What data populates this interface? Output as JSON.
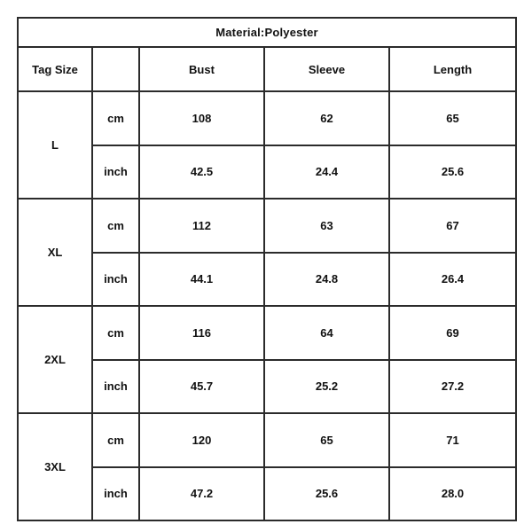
{
  "chart_data": {
    "type": "table",
    "title": "Material:Polyester",
    "columns": [
      "Tag Size",
      "",
      "Bust",
      "Sleeve",
      "Length"
    ],
    "units": [
      "cm",
      "inch"
    ],
    "rows": [
      {
        "tag_size": "L",
        "cm": {
          "unit": "cm",
          "bust": "108",
          "sleeve": "62",
          "length": "65"
        },
        "inch": {
          "unit": "inch",
          "bust": "42.5",
          "sleeve": "24.4",
          "length": "25.6"
        }
      },
      {
        "tag_size": "XL",
        "cm": {
          "unit": "cm",
          "bust": "112",
          "sleeve": "63",
          "length": "67"
        },
        "inch": {
          "unit": "inch",
          "bust": "44.1",
          "sleeve": "24.8",
          "length": "26.4"
        }
      },
      {
        "tag_size": "2XL",
        "cm": {
          "unit": "cm",
          "bust": "116",
          "sleeve": "64",
          "length": "69"
        },
        "inch": {
          "unit": "inch",
          "bust": "45.7",
          "sleeve": "25.2",
          "length": "27.2"
        }
      },
      {
        "tag_size": "3XL",
        "cm": {
          "unit": "cm",
          "bust": "120",
          "sleeve": "65",
          "length": "71"
        },
        "inch": {
          "unit": "inch",
          "bust": "47.2",
          "sleeve": "25.6",
          "length": "28.0"
        }
      }
    ],
    "shaded_rows": "inch",
    "colors": {
      "shaded_background": "#c0c0c0",
      "cell_background": "#ffffff",
      "border": "#2b2b2b",
      "text": "#111111"
    }
  },
  "table": {
    "title": "Material:Polyester",
    "header": {
      "tag_size": "Tag Size",
      "unit": "",
      "bust": "Bust",
      "sleeve": "Sleeve",
      "length": "Length"
    }
  }
}
